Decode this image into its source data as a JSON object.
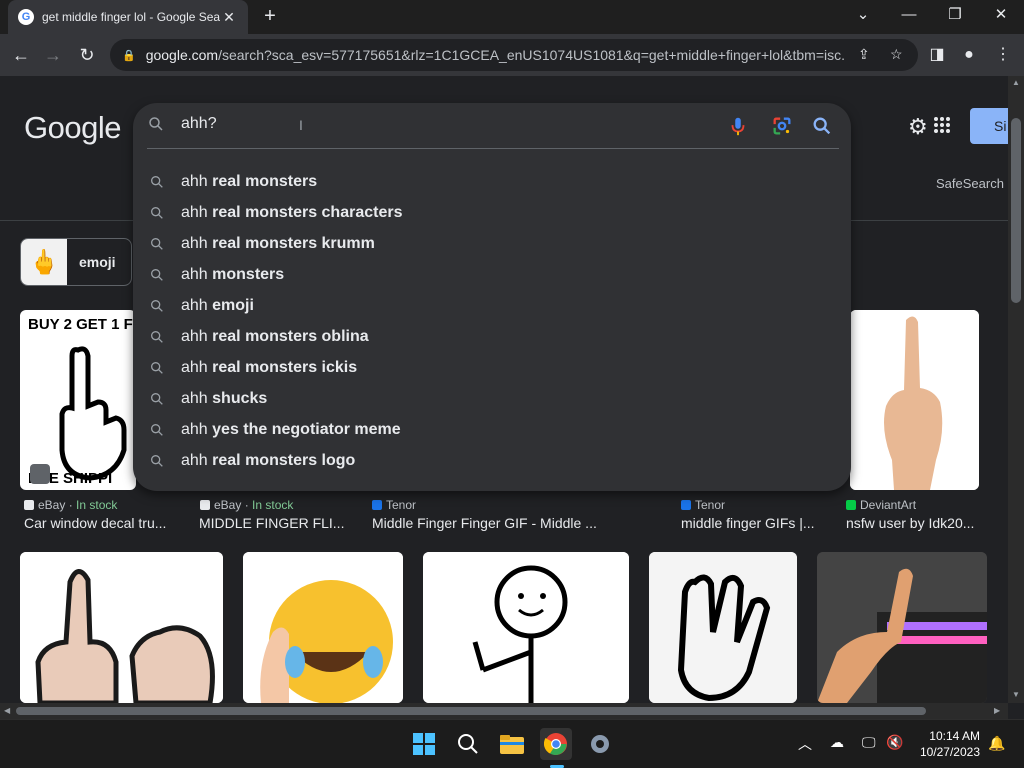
{
  "browser": {
    "tab_title": "get middle finger lol - Google Search",
    "url_host": "google.com",
    "url_rest": "/search?sca_esv=577175651&rlz=1C1GCEA_enUS1074US1081&q=get+middle+finger+lol&tbm=isc...",
    "new_tab": "+",
    "back": "←",
    "forward": "→",
    "reload": "↻"
  },
  "google": {
    "logo": "Google",
    "signin": "Si",
    "safesearch": "SafeSearch"
  },
  "search": {
    "query": "ahh?",
    "suggestions": [
      {
        "prefix": "ahh",
        "bold": " real monsters"
      },
      {
        "prefix": "ahh",
        "bold": " real monsters characters"
      },
      {
        "prefix": "ahh",
        "bold": " real monsters krumm"
      },
      {
        "prefix": "ahh",
        "bold": " monsters"
      },
      {
        "prefix": "ahh",
        "bold": " emoji"
      },
      {
        "prefix": "ahh",
        "bold": " real monsters oblina"
      },
      {
        "prefix": "ahh",
        "bold": " real monsters ickis"
      },
      {
        "prefix": "ahh",
        "bold": " shucks"
      },
      {
        "prefix": "ahh",
        "bold": " yes the negotiator meme"
      },
      {
        "prefix": "ahh",
        "bold": " real monsters logo"
      }
    ]
  },
  "chips": [
    {
      "label": "emoji"
    }
  ],
  "results_row1": [
    {
      "banner": "BUY 2 GET 1 F",
      "banner_bottom": "REE SHIPPI",
      "source": "eBay",
      "stock": "In stock",
      "title": "Car window decal tru..."
    },
    {
      "source": "eBay",
      "stock": "In stock",
      "title": "MIDDLE FINGER FLI..."
    },
    {
      "source": "Tenor",
      "stock": "",
      "title": "Middle Finger Finger GIF - Middle ..."
    },
    {
      "source": "Tenor",
      "stock": "",
      "title": "middle finger GIFs |..."
    },
    {
      "source": "DeviantArt",
      "stock": "",
      "title": "nsfw user by Idk20..."
    }
  ],
  "taskbar": {
    "time": "10:14 AM",
    "date": "10/27/2023"
  },
  "colors": {
    "bg": "#202124",
    "dropdown": "#303134",
    "accent": "#8ab4f8"
  }
}
